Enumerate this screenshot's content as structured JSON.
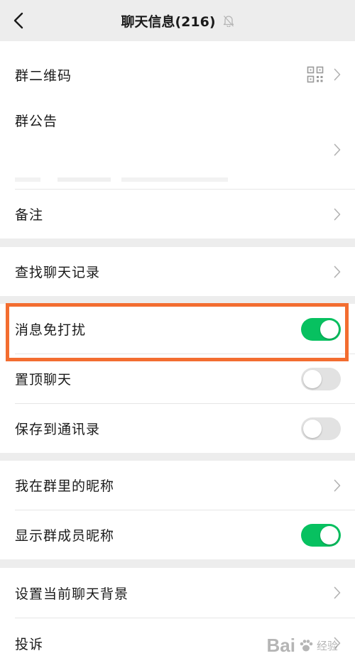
{
  "header": {
    "title": "聊天信息(216)",
    "mute_icon": "bell-off-icon"
  },
  "group": {
    "qr_code_label": "群二维码",
    "announcement_label": "群公告",
    "remark_label": "备注"
  },
  "search": {
    "label": "查找聊天记录"
  },
  "settings": {
    "mute_label": "消息免打扰",
    "mute_on": true,
    "pin_label": "置顶聊天",
    "pin_on": false,
    "save_contacts_label": "保存到通讯录",
    "save_contacts_on": false
  },
  "nickname": {
    "my_nickname_label": "我在群里的昵称",
    "show_nicknames_label": "显示群成员昵称",
    "show_nicknames_on": true
  },
  "more": {
    "background_label": "设置当前聊天背景",
    "complain_label": "投诉"
  },
  "colors": {
    "toggle_on": "#07c160",
    "toggle_off": "#e2e2e2",
    "highlight": "#f36d30"
  },
  "watermark": {
    "text": "Bai",
    "sub": "经验"
  }
}
